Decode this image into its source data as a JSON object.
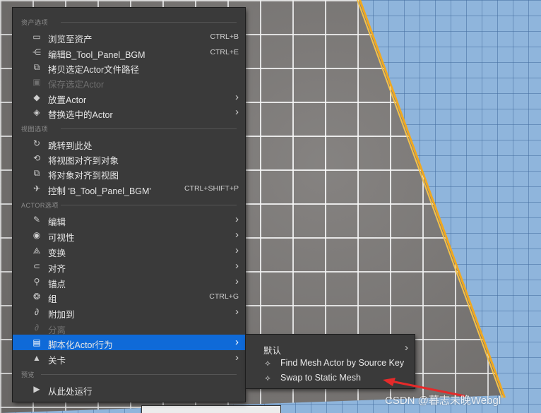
{
  "main_menu": {
    "asset_section": {
      "title": "资产选项",
      "items": [
        {
          "label": "浏览至资产",
          "icon": "folder-search-icon",
          "shortcut": "CTRL+B"
        },
        {
          "label": "编辑B_Tool_Panel_BGM",
          "icon": "blueprint-edit-icon",
          "shortcut": "CTRL+E"
        },
        {
          "label": "拷贝选定Actor文件路径",
          "icon": "copy-path-icon",
          "shortcut": ""
        },
        {
          "label": "保存选定Actor",
          "icon": "save-icon",
          "shortcut": "",
          "disabled": true
        },
        {
          "label": "放置Actor",
          "icon": "place-actor-icon",
          "shortcut": ""
        },
        {
          "label": "替换选中的Actor",
          "icon": "replace-actor-icon",
          "shortcut": ""
        }
      ]
    },
    "view_section": {
      "title": "视图选项",
      "items": [
        {
          "label": "跳转到此处",
          "icon": "goto-icon",
          "shortcut": ""
        },
        {
          "label": "将视图对齐到对象",
          "icon": "snap-view-icon",
          "shortcut": ""
        },
        {
          "label": "将对象对齐到视图",
          "icon": "snap-object-icon",
          "shortcut": ""
        },
        {
          "label": "控制 'B_Tool_Panel_BGM'",
          "icon": "pilot-icon",
          "shortcut": "CTRL+SHIFT+P"
        }
      ]
    },
    "actor_section": {
      "title": "ACTOR选项",
      "items": [
        {
          "label": "编辑",
          "icon": "pencil-icon",
          "shortcut": ""
        },
        {
          "label": "可视性",
          "icon": "eye-icon",
          "shortcut": ""
        },
        {
          "label": "变换",
          "icon": "transform-icon",
          "shortcut": ""
        },
        {
          "label": "对齐",
          "icon": "magnet-icon",
          "shortcut": ""
        },
        {
          "label": "锚点",
          "icon": "pivot-icon",
          "shortcut": ""
        },
        {
          "label": "组",
          "icon": "group-icon",
          "shortcut": "CTRL+G"
        },
        {
          "label": "附加到",
          "icon": "paperclip-icon",
          "shortcut": ""
        },
        {
          "label": "分离",
          "icon": "detach-icon",
          "shortcut": "",
          "disabled": true
        },
        {
          "label": "脚本化Actor行为",
          "icon": "script-icon",
          "shortcut": "",
          "highlighted": true
        },
        {
          "label": "关卡",
          "icon": "level-icon",
          "shortcut": ""
        }
      ]
    },
    "preview_section": {
      "title": "预览",
      "items": [
        {
          "label": "从此处运行",
          "icon": "play-icon",
          "shortcut": ""
        }
      ]
    }
  },
  "sub_menu": {
    "items": [
      {
        "label": "默认",
        "icon": ""
      },
      {
        "label": "Find Mesh Actor by Source Key",
        "icon": "diamond-arrows-icon"
      },
      {
        "label": "Swap to Static Mesh",
        "icon": "diamond-arrows-icon"
      }
    ]
  },
  "watermark": "CSDN @暮志未晚Webgl",
  "colors": {
    "menu_bg": "#3a3a3a",
    "highlight": "#0f6ad8",
    "floor_edge": "#f0a820"
  }
}
